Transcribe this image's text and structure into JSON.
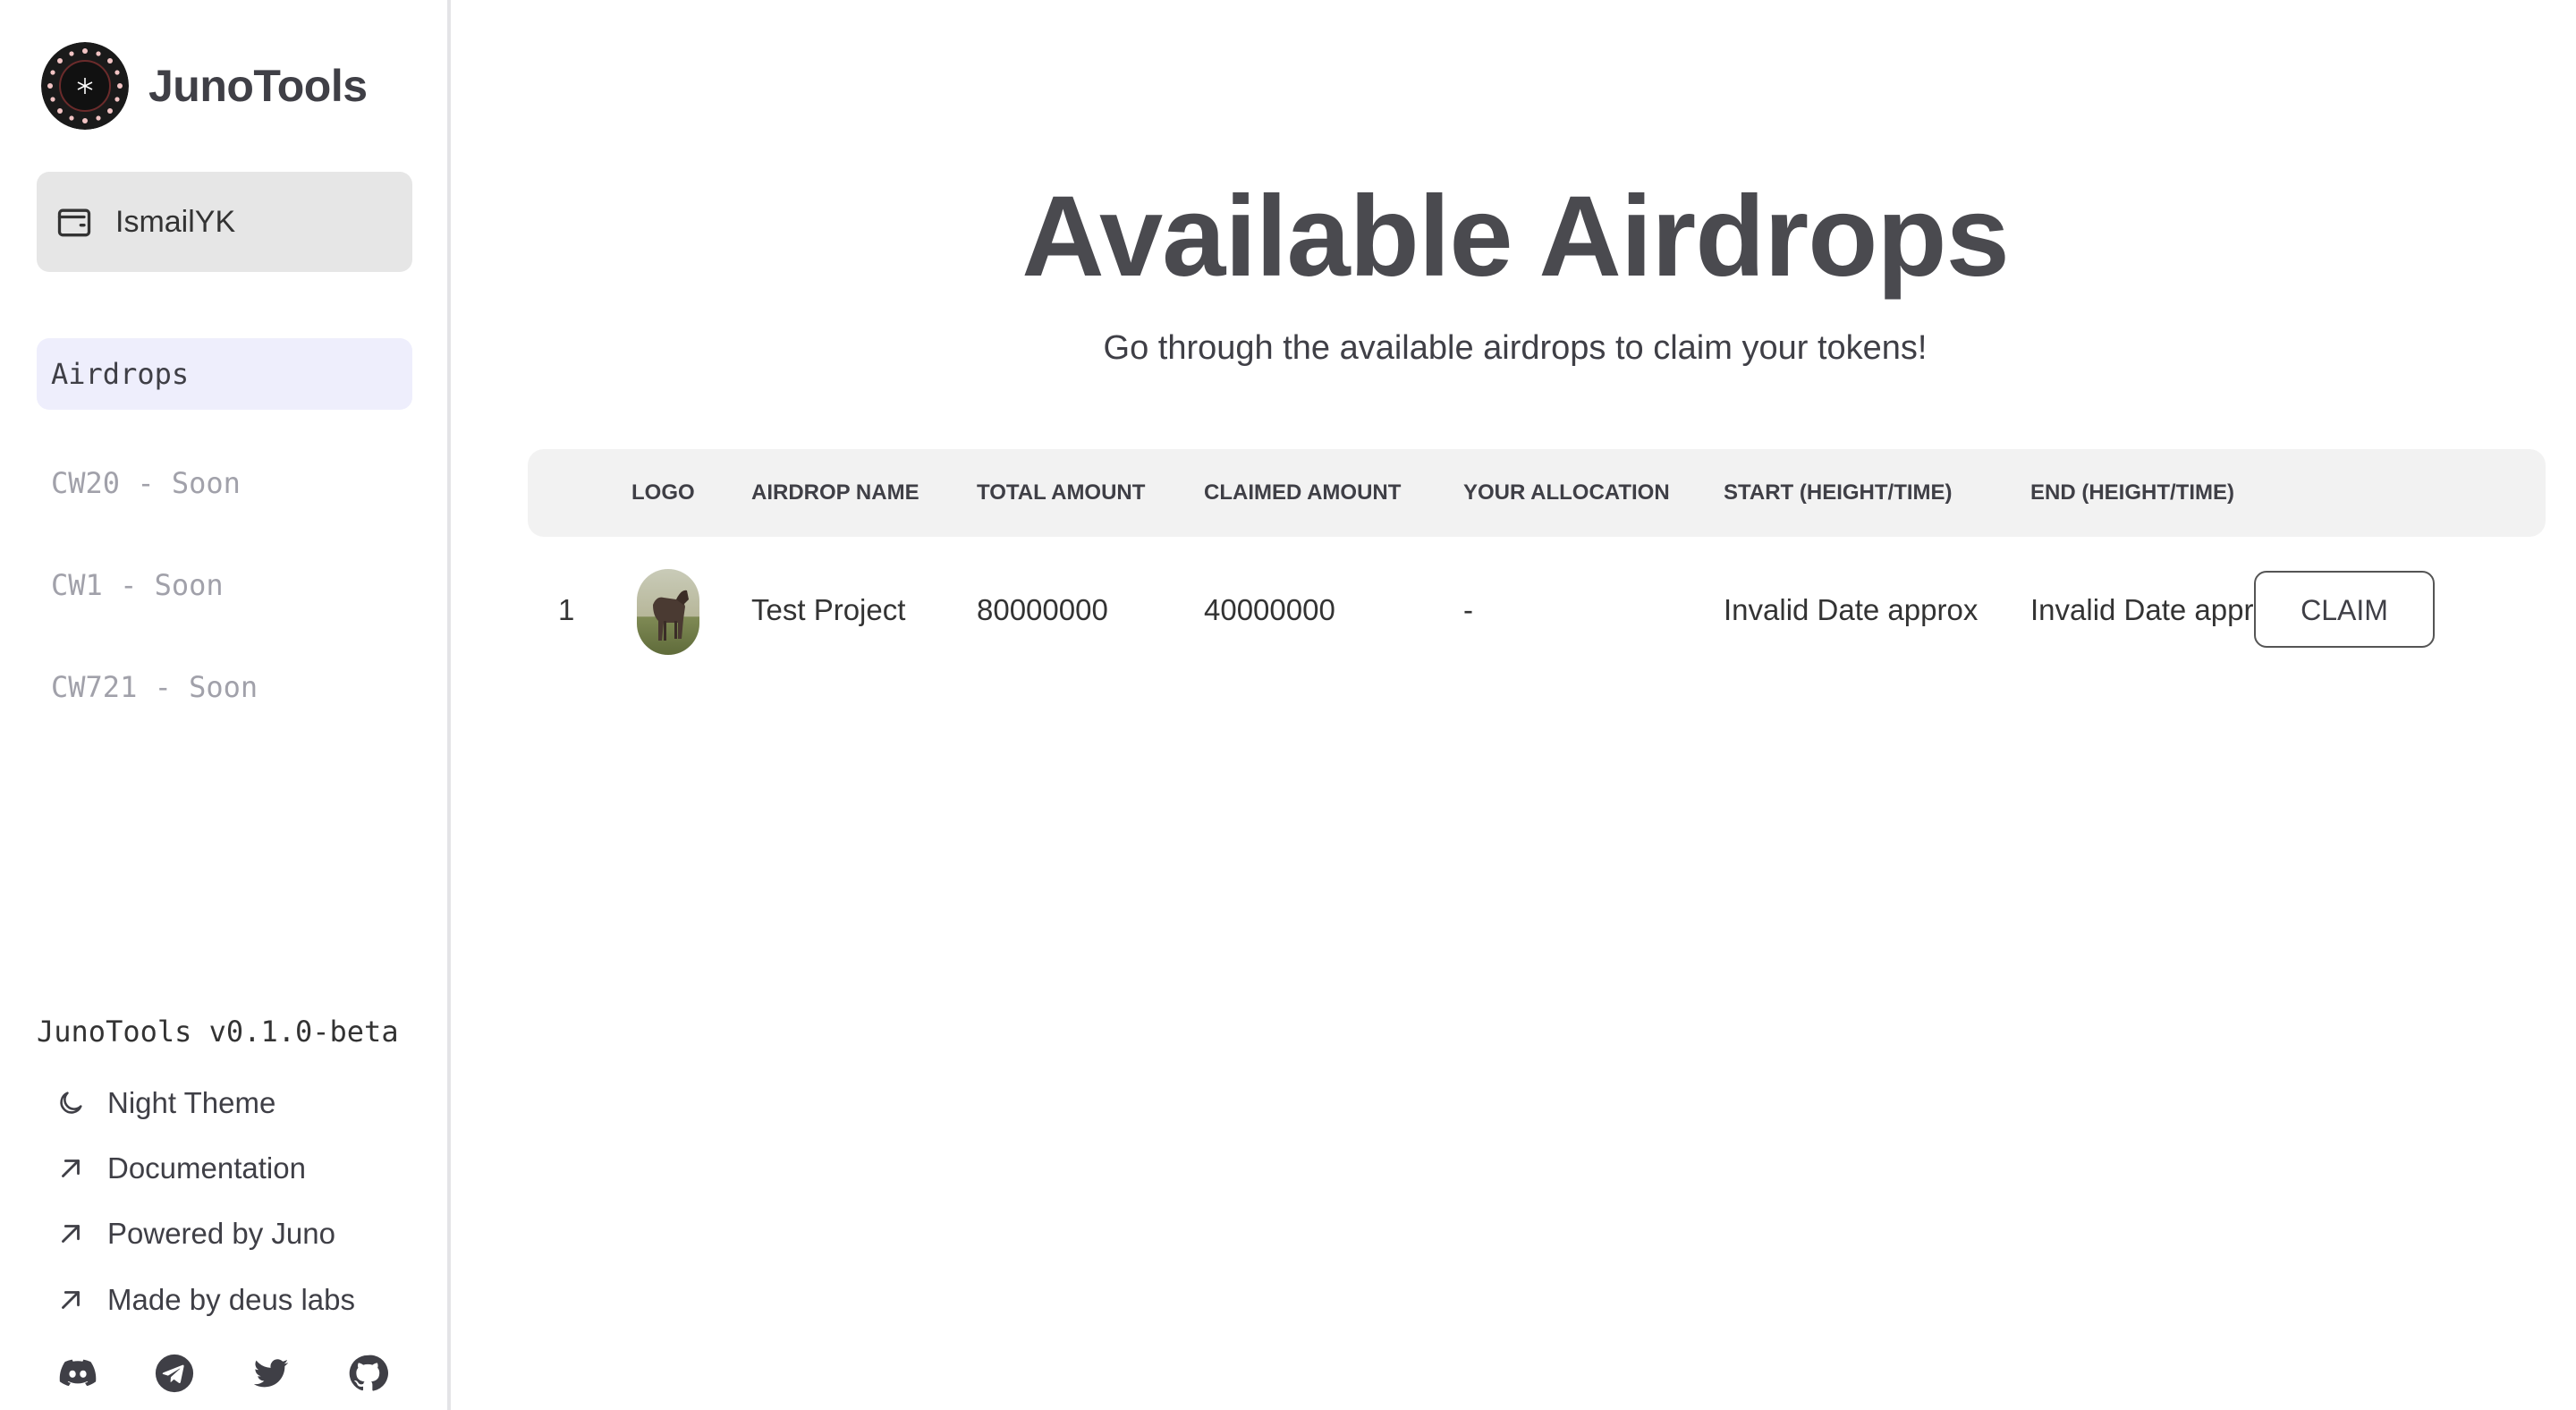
{
  "sidebar": {
    "brand": {
      "title": "JunoTools",
      "logo_icon": "juno-logo-icon"
    },
    "wallet": {
      "label": "IsmailYK",
      "icon": "wallet-icon"
    },
    "nav": [
      {
        "label": "Airdrops",
        "active": true,
        "disabled": false
      },
      {
        "label": "CW20 - Soon",
        "active": false,
        "disabled": true
      },
      {
        "label": "CW1 - Soon",
        "active": false,
        "disabled": true
      },
      {
        "label": "CW721 - Soon",
        "active": false,
        "disabled": true
      }
    ],
    "version": "JunoTools v0.1.0-beta",
    "footer_links": [
      {
        "label": "Night Theme",
        "icon": "moon-icon"
      },
      {
        "label": "Documentation",
        "icon": "arrow-up-right-icon"
      },
      {
        "label": "Powered by Juno",
        "icon": "arrow-up-right-icon"
      },
      {
        "label": "Made by deus labs",
        "icon": "arrow-up-right-icon"
      }
    ],
    "socials": [
      "discord-icon",
      "telegram-icon",
      "twitter-icon",
      "github-icon"
    ]
  },
  "main": {
    "title": "Available Airdrops",
    "subtitle": "Go through the available airdrops to claim your tokens!",
    "table": {
      "columns": [
        "LOGO",
        "AIRDROP NAME",
        "TOTAL AMOUNT",
        "CLAIMED AMOUNT",
        "YOUR ALLOCATION",
        "START (HEIGHT/TIME)",
        "END (HEIGHT/TIME)"
      ],
      "rows": [
        {
          "index": "1",
          "logo_icon": "project-logo-image",
          "name": "Test Project",
          "total_amount": "80000000",
          "claimed_amount": "40000000",
          "allocation": "-",
          "start": "Invalid Date approx",
          "end": "Invalid Date approx",
          "action_label": "CLAIM"
        }
      ]
    }
  },
  "colors": {
    "nav_active_bg": "#eeeefc",
    "wallet_bg": "#e6e6e6",
    "header_bg": "#f2f2f2",
    "disabled_text": "#a1a1aa"
  }
}
